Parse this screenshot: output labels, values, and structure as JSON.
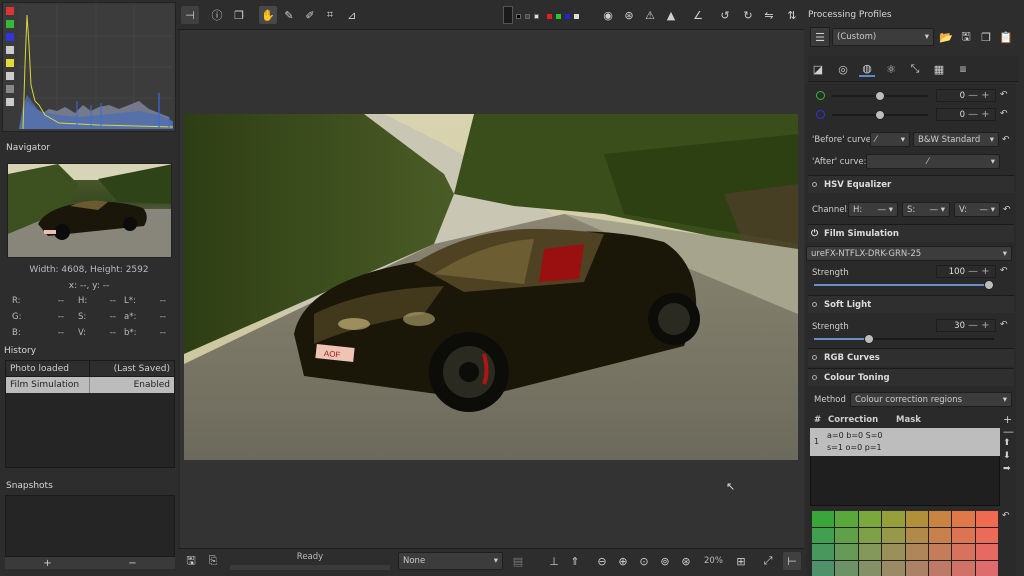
{
  "histogram": {
    "colors": [
      "#d33",
      "#3b3",
      "#33d",
      "#ccc",
      "#dd3",
      "#ccc",
      "#999",
      "#ccc"
    ]
  },
  "navigator": {
    "title": "Navigator",
    "dimensions": "Width: 4608, Height: 2592",
    "coords": "x: --, y: --",
    "readouts": [
      {
        "label": "R:",
        "value": "--"
      },
      {
        "label": "H:",
        "value": "--"
      },
      {
        "label": "L*:",
        "value": "--"
      },
      {
        "label": "G:",
        "value": "--"
      },
      {
        "label": "S:",
        "value": "--"
      },
      {
        "label": "a*:",
        "value": "--"
      },
      {
        "label": "B:",
        "value": "--"
      },
      {
        "label": "V:",
        "value": "--"
      },
      {
        "label": "b*:",
        "value": "--"
      }
    ]
  },
  "history": {
    "title": "History",
    "rows": [
      {
        "name": "Photo loaded",
        "value": "(Last Saved)"
      },
      {
        "name": "Film Simulation",
        "value": "Enabled"
      }
    ]
  },
  "snapshots": {
    "title": "Snapshots",
    "add": "+",
    "remove": "−"
  },
  "statusbar": {
    "status": "Ready",
    "preview_combo": "None",
    "zoom": "20%"
  },
  "profiles": {
    "title": "Processing Profiles",
    "selected": "(Custom)"
  },
  "tools": {
    "before_curve_label": "'Before' curve:",
    "before_curve_mode": "B&W Standard",
    "after_curve_label": "'After' curve:",
    "slider1_value": "0",
    "slider2_value": "0",
    "hsv": {
      "title": "HSV Equalizer",
      "channel_label": "Channel:",
      "h": "H:",
      "s": "S:",
      "v": "V:"
    },
    "film": {
      "title": "Film Simulation",
      "clut": "ureFX-NTFLX-DRK-GRN-25",
      "strength_label": "Strength",
      "strength_value": "100"
    },
    "soft_light": {
      "title": "Soft Light",
      "strength_label": "Strength",
      "strength_value": "30"
    },
    "rgb_curves": {
      "title": "RGB Curves"
    },
    "colour_toning": {
      "title": "Colour Toning",
      "method_label": "Method",
      "method_value": "Colour correction regions",
      "col_hash": "#",
      "col_correction": "Correction",
      "col_mask": "Mask",
      "row_index": "1",
      "row_line1": "a=0 b=0 S=0",
      "row_line2": "s=1 o=0 p=1"
    }
  },
  "grid_colors": [
    [
      "#3aa63a",
      "#5aa83a",
      "#7aa83a",
      "#96a03a",
      "#b09038",
      "#c88440",
      "#e07848",
      "#f06a50"
    ],
    [
      "#40a050",
      "#60a048",
      "#80a048",
      "#98984a",
      "#b08a48",
      "#c8804c",
      "#dc7452",
      "#ec6a58"
    ],
    [
      "#48985e",
      "#669a58",
      "#84985a",
      "#9a905a",
      "#ae8658",
      "#c47c5a",
      "#d6725e",
      "#e66a62"
    ],
    [
      "#50906a",
      "#6c9266",
      "#869066",
      "#9a8a66",
      "#ac8266",
      "#be7a66",
      "#d07268",
      "#de6c6c"
    ]
  ]
}
